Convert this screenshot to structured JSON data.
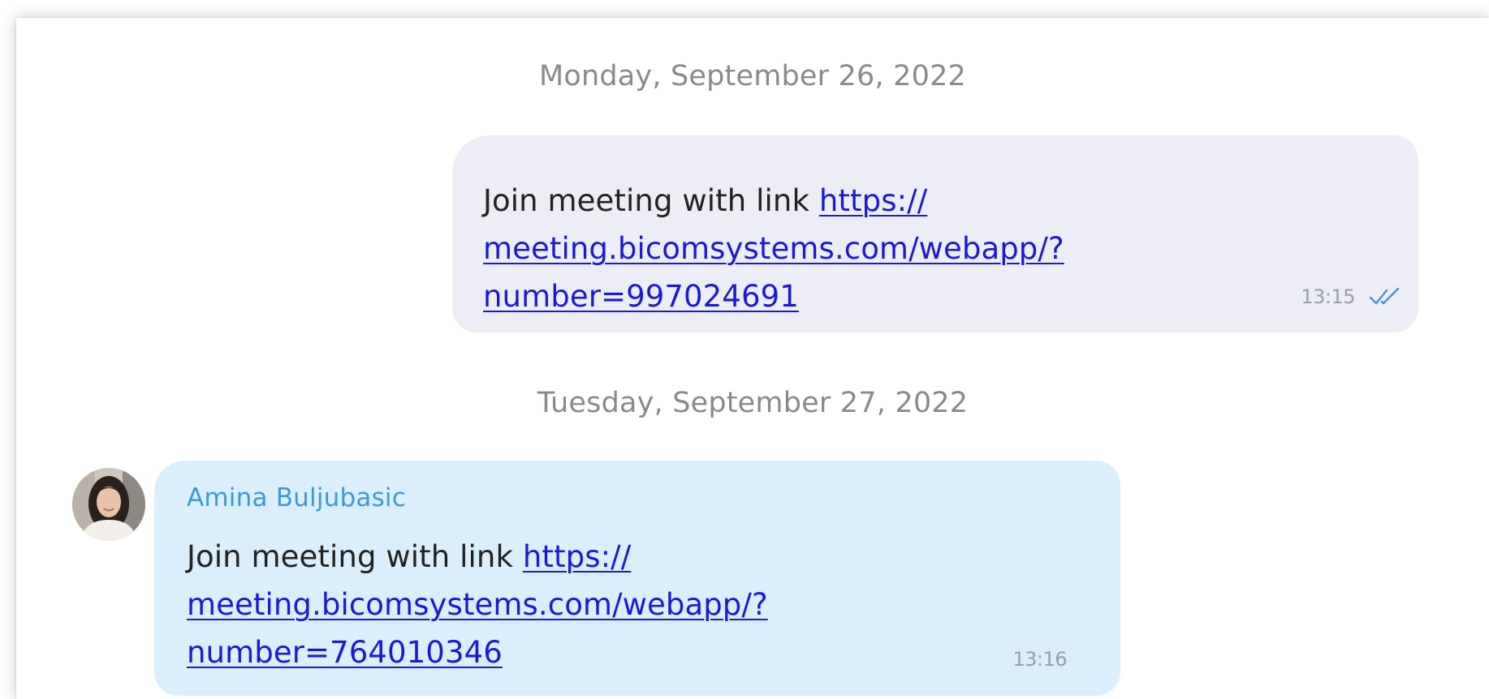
{
  "conversation": {
    "dates": [
      "Monday, September 26, 2022",
      "Tuesday, September 27, 2022"
    ],
    "messages": [
      {
        "direction": "outgoing",
        "text_prefix": "Join meeting with link ",
        "link_line1": "https://",
        "link_line2": "meeting.bicomsystems.com/webapp/?",
        "link_line3": "number=997024691",
        "time": "13:15",
        "status_icon": "double-check-icon"
      },
      {
        "direction": "incoming",
        "sender": "Amina Buljubasic",
        "avatar_icon": "user-avatar",
        "text_prefix": "Join meeting with link ",
        "link_line1": "https://",
        "link_line2": "meeting.bicomsystems.com/webapp/?",
        "link_line3": "number=764010346",
        "time": "13:16"
      }
    ]
  },
  "colors": {
    "outgoing_bubble": "#edeef5",
    "incoming_bubble": "#daeefc",
    "link": "#1a19d6",
    "sender_name": "#3c9bd4",
    "read_check": "#4a90d9",
    "date_text": "#8a8a8a",
    "timestamp": "#9b9ea6"
  }
}
